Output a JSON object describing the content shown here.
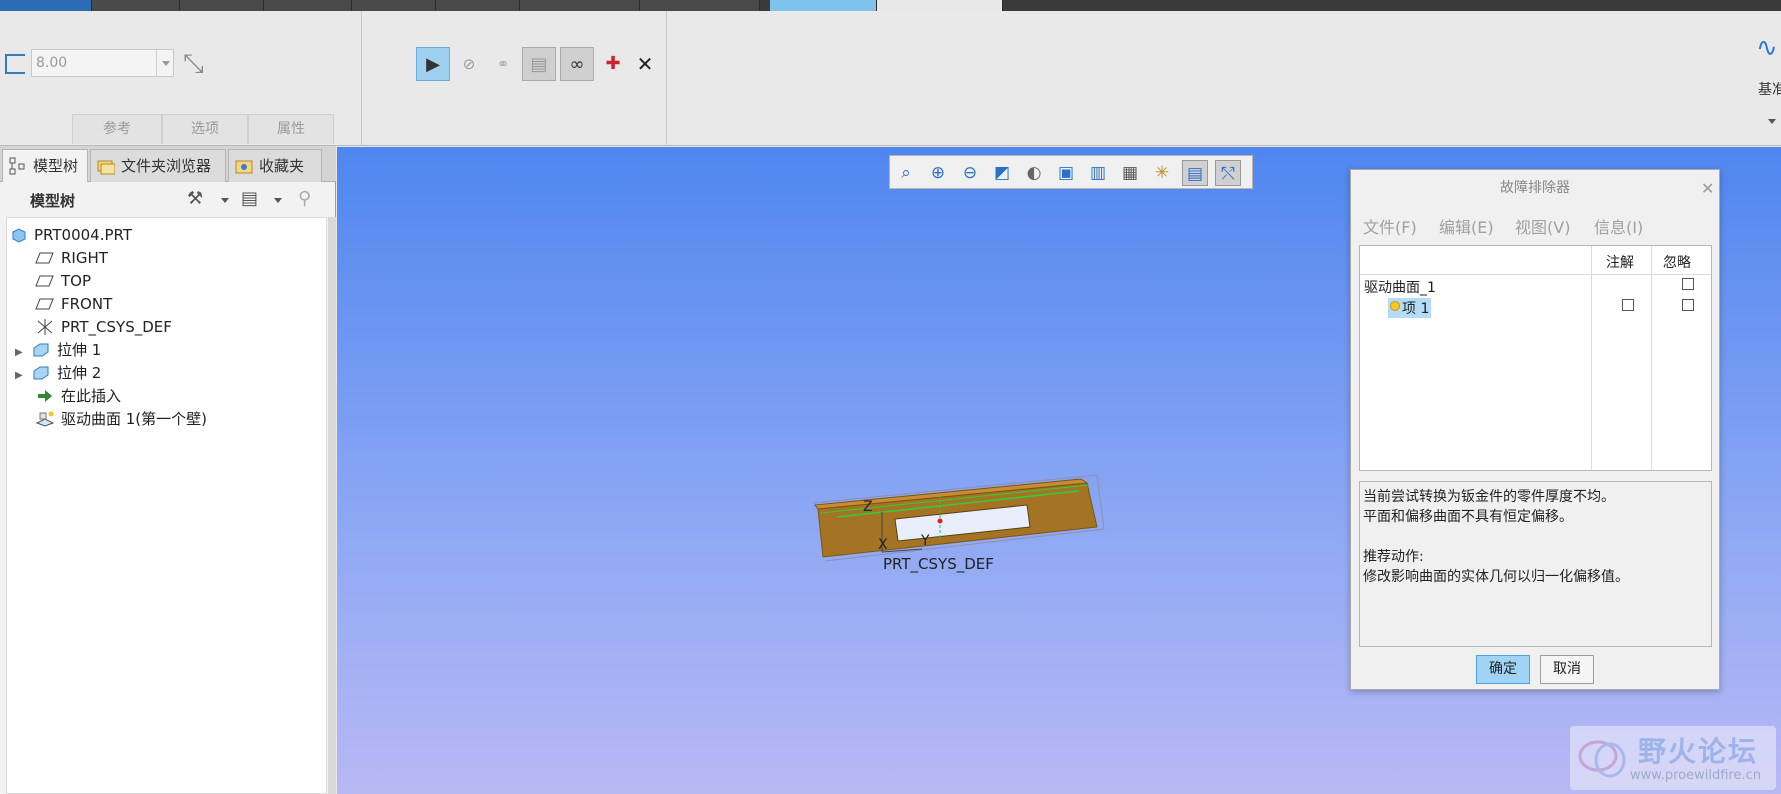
{
  "ribbon": {
    "thickness_value": "8.00",
    "tabs": [
      "参考",
      "选项",
      "属性"
    ],
    "datum_label": "基准"
  },
  "left_panel": {
    "tabs": [
      "模型树",
      "文件夹浏览器",
      "收藏夹"
    ],
    "tree_header": "模型树",
    "tree": [
      {
        "label": "PRT0004.PRT",
        "level": 0,
        "icon": "part-icon"
      },
      {
        "label": "RIGHT",
        "level": 1,
        "icon": "datum-plane-icon"
      },
      {
        "label": "TOP",
        "level": 1,
        "icon": "datum-plane-icon"
      },
      {
        "label": "FRONT",
        "level": 1,
        "icon": "datum-plane-icon"
      },
      {
        "label": "PRT_CSYS_DEF",
        "level": 1,
        "icon": "csys-icon"
      },
      {
        "label": "拉伸 1",
        "level": 1,
        "icon": "extrude-icon",
        "expandable": true
      },
      {
        "label": "拉伸 2",
        "level": 1,
        "icon": "extrude-icon",
        "expandable": true
      },
      {
        "label": "在此插入",
        "level": 1,
        "icon": "insert-here-icon"
      },
      {
        "label": "驱动曲面 1(第一个壁)",
        "level": 1,
        "icon": "driving-surface-icon"
      }
    ]
  },
  "viewport": {
    "csys_label": "PRT_CSYS_DEF",
    "axis_labels": {
      "x": "X",
      "y": "Y",
      "z": "Z"
    }
  },
  "dialog": {
    "title": "故障排除器",
    "menu": [
      "文件(F)",
      "编辑(E)",
      "视图(V)",
      "信息(I)"
    ],
    "columns": {
      "note": "注解",
      "ignore": "忽略"
    },
    "rows": [
      {
        "label": "驱动曲面_1"
      },
      {
        "label": "项 1"
      }
    ],
    "message_lines": [
      "当前尝试转换为钣金件的零件厚度不均。",
      "平面和偏移曲面不具有恒定偏移。",
      "",
      "推荐动作:",
      "修改影响曲面的实体几何以归一化偏移值。"
    ],
    "ok_label": "确定",
    "cancel_label": "取消"
  },
  "watermark": {
    "title": "野火论坛",
    "url": "www.proewildfire.cn"
  }
}
